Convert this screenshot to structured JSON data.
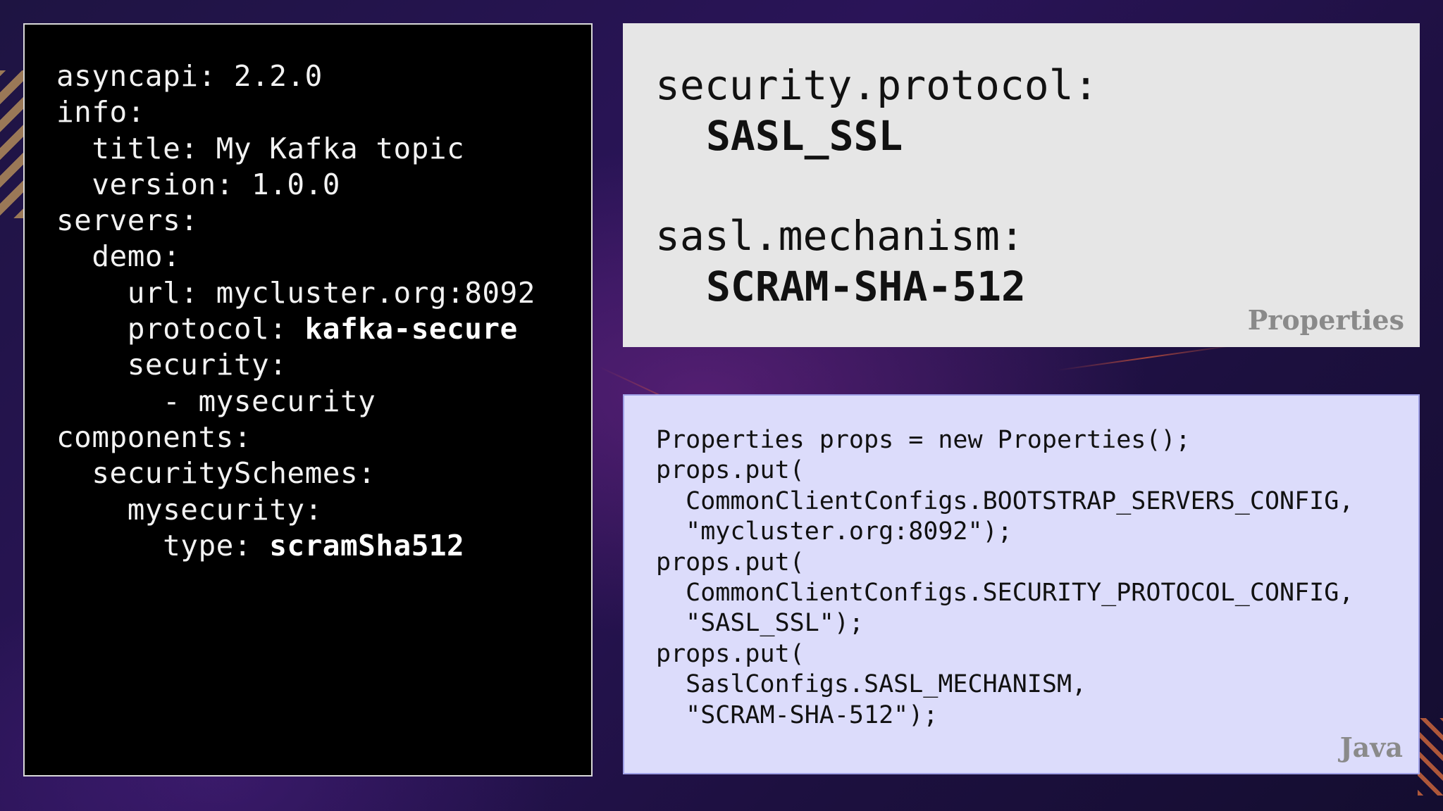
{
  "yaml": {
    "lines": [
      {
        "indent": "",
        "text": "asyncapi: 2.2.0",
        "strong": ""
      },
      {
        "indent": "",
        "text": "info:",
        "strong": ""
      },
      {
        "indent": "  ",
        "text": "title: My Kafka topic",
        "strong": ""
      },
      {
        "indent": "  ",
        "text": "version: 1.0.0",
        "strong": ""
      },
      {
        "indent": "",
        "text": "servers:",
        "strong": ""
      },
      {
        "indent": "  ",
        "text": "demo:",
        "strong": ""
      },
      {
        "indent": "    ",
        "text": "url: mycluster.org:8092",
        "strong": ""
      },
      {
        "indent": "    ",
        "text": "protocol: ",
        "strong": "kafka-secure"
      },
      {
        "indent": "    ",
        "text": "security:",
        "strong": ""
      },
      {
        "indent": "      ",
        "text": "- mysecurity",
        "strong": ""
      },
      {
        "indent": "",
        "text": "components:",
        "strong": ""
      },
      {
        "indent": "  ",
        "text": "securitySchemes:",
        "strong": ""
      },
      {
        "indent": "    ",
        "text": "mysecurity:",
        "strong": ""
      },
      {
        "indent": "      ",
        "text": "type: ",
        "strong": "scramSha512"
      }
    ]
  },
  "properties": {
    "items": [
      {
        "key": "security.protocol:",
        "value": "SASL_SSL"
      },
      {
        "key": "sasl.mechanism:",
        "value": "SCRAM-SHA-512"
      }
    ],
    "tag": "Properties"
  },
  "java": {
    "lines": [
      "Properties props = new Properties();",
      "props.put(",
      "  CommonClientConfigs.BOOTSTRAP_SERVERS_CONFIG,",
      "  \"mycluster.org:8092\");",
      "props.put(",
      "  CommonClientConfigs.SECURITY_PROTOCOL_CONFIG,",
      "  \"SASL_SSL\");",
      "props.put(",
      "  SaslConfigs.SASL_MECHANISM,",
      "  \"SCRAM-SHA-512\");"
    ],
    "tag": "Java"
  },
  "colors": {
    "yaml_bg": "#000000",
    "properties_bg": "#e6e6e6",
    "java_bg": "#dcdcfb",
    "tag_text": "#8a8a8a"
  }
}
